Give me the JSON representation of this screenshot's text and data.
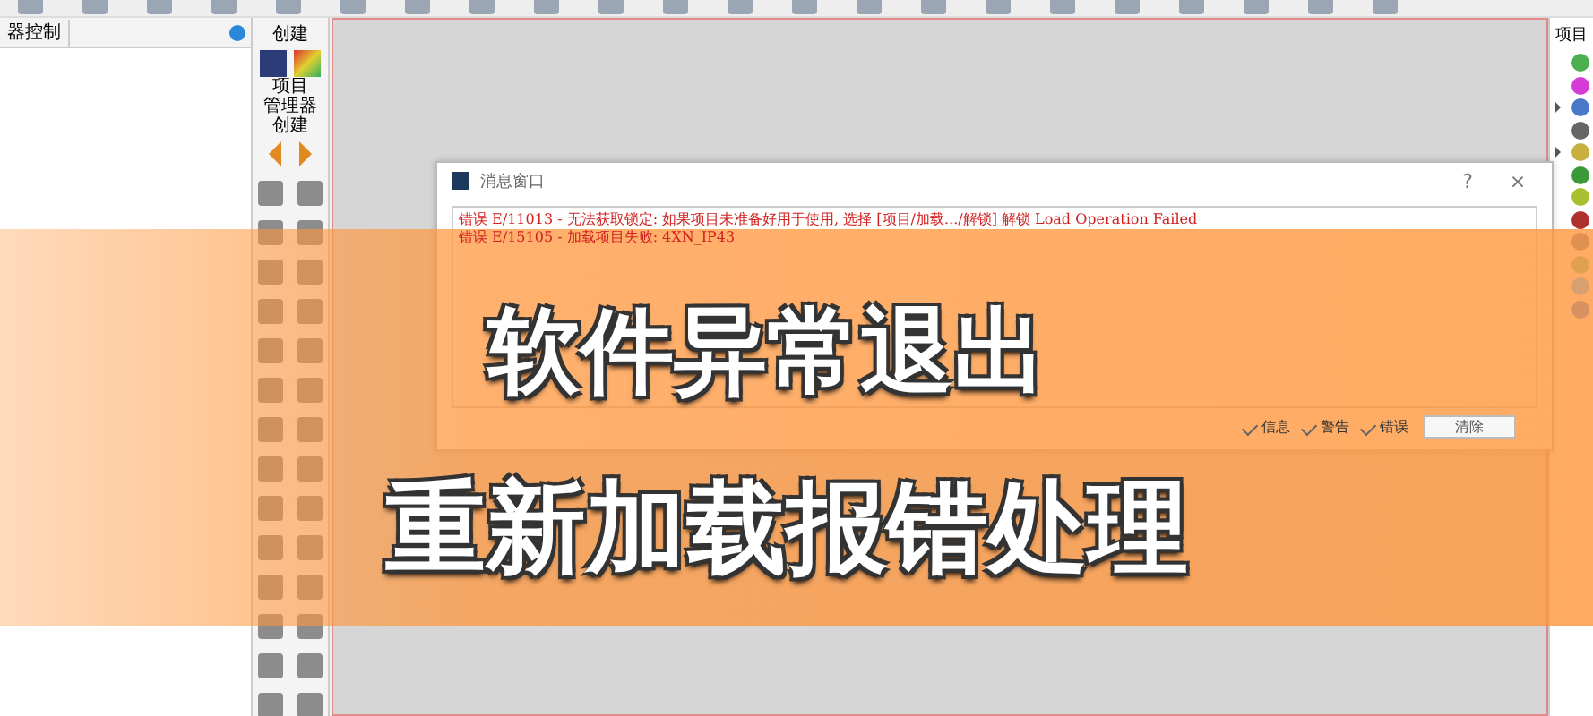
{
  "left_panel": {
    "tab": "器控制"
  },
  "palette": {
    "title": "创建",
    "section_title": [
      "项目",
      "管理器",
      "创建"
    ]
  },
  "project_panel": {
    "title": "项目",
    "items": [
      {
        "color": "#4caf50",
        "expandable": false
      },
      {
        "color": "#d63bd6",
        "expandable": false
      },
      {
        "color": "#4a78c8",
        "expandable": true
      },
      {
        "color": "#666666",
        "expandable": false
      },
      {
        "color": "#c8b040",
        "expandable": true
      },
      {
        "color": "#3a9a3a",
        "expandable": false
      },
      {
        "color": "#a8c030",
        "expandable": false
      },
      {
        "color": "#b03030",
        "expandable": false
      },
      {
        "color": "#e09050",
        "expandable": false
      },
      {
        "color": "#e0a050",
        "expandable": false
      },
      {
        "color": "#d8a070",
        "expandable": false
      },
      {
        "color": "#d89060",
        "expandable": false
      }
    ]
  },
  "dialog": {
    "title": "消息窗口",
    "help": "?",
    "close": "×",
    "messages": [
      "错误 E/11013 - 无法获取锁定: 如果项目未准备好用于使用, 选择 [项目/加载.../解锁] 解锁 Load Operation Failed",
      "错误 E/15105 - 加载项目失败:  4XN_IP43"
    ],
    "filters": [
      {
        "label": "信息",
        "checked": true
      },
      {
        "label": "警告",
        "checked": true
      },
      {
        "label": "错误",
        "checked": true
      }
    ],
    "clear_button": "清除"
  },
  "banner": {
    "title": "软件异常退出",
    "subtitle": "重新加载报错处理"
  }
}
